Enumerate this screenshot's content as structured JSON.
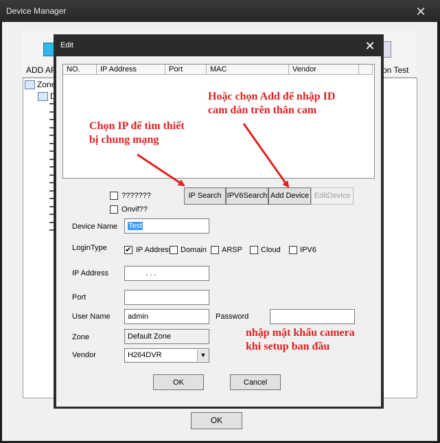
{
  "outer": {
    "title": "Device Manager",
    "toolbar_left_label": "ADD AR",
    "toolbar_right_label": "on Test",
    "tree_root": "Zone",
    "tree_child": "D",
    "ok_label": "OK"
  },
  "edit": {
    "title": "Edit",
    "columns": [
      "NO.",
      "IP Address",
      "Port",
      "MAC",
      "Vendor"
    ],
    "checkbox1_label": "???????",
    "checkbox2_label": "Onvif??",
    "buttons": {
      "ip_search": "IP Search",
      "ipv6_search": "IPV6Search",
      "add_device": "Add Device",
      "edit_device": "EditDevice"
    },
    "device_name_label": "Device Name",
    "device_name_value": "Test",
    "login_type_label": "LoginType",
    "login_options": [
      {
        "label": "IP Address",
        "checked": true
      },
      {
        "label": "Domain",
        "checked": false
      },
      {
        "label": "ARSP",
        "checked": false
      },
      {
        "label": "Cloud",
        "checked": false
      },
      {
        "label": "IPV6",
        "checked": false
      }
    ],
    "check_mark": "✔",
    "ip_label": "IP Address",
    "ip_value": ".   .   .",
    "port_label": "Port",
    "port_value": "",
    "user_label": "User Name",
    "user_value": "admin",
    "password_label": "Password",
    "password_value": "",
    "zone_label": "Zone",
    "zone_value": "Default Zone",
    "vendor_label": "Vendor",
    "vendor_value": "H264DVR",
    "ok_label": "OK",
    "cancel_label": "Cancel"
  },
  "annotations": {
    "ip_search_note": [
      "Chọn IP để tìm thiết",
      "bị chung mạng"
    ],
    "add_note": [
      "Hoặc chọn Add để nhập ID",
      "cam dán trên thân cam"
    ],
    "password_note": [
      "nhập mật khẩu camera",
      "khi setup ban đầu"
    ],
    "arrow_color": "#e02020"
  }
}
